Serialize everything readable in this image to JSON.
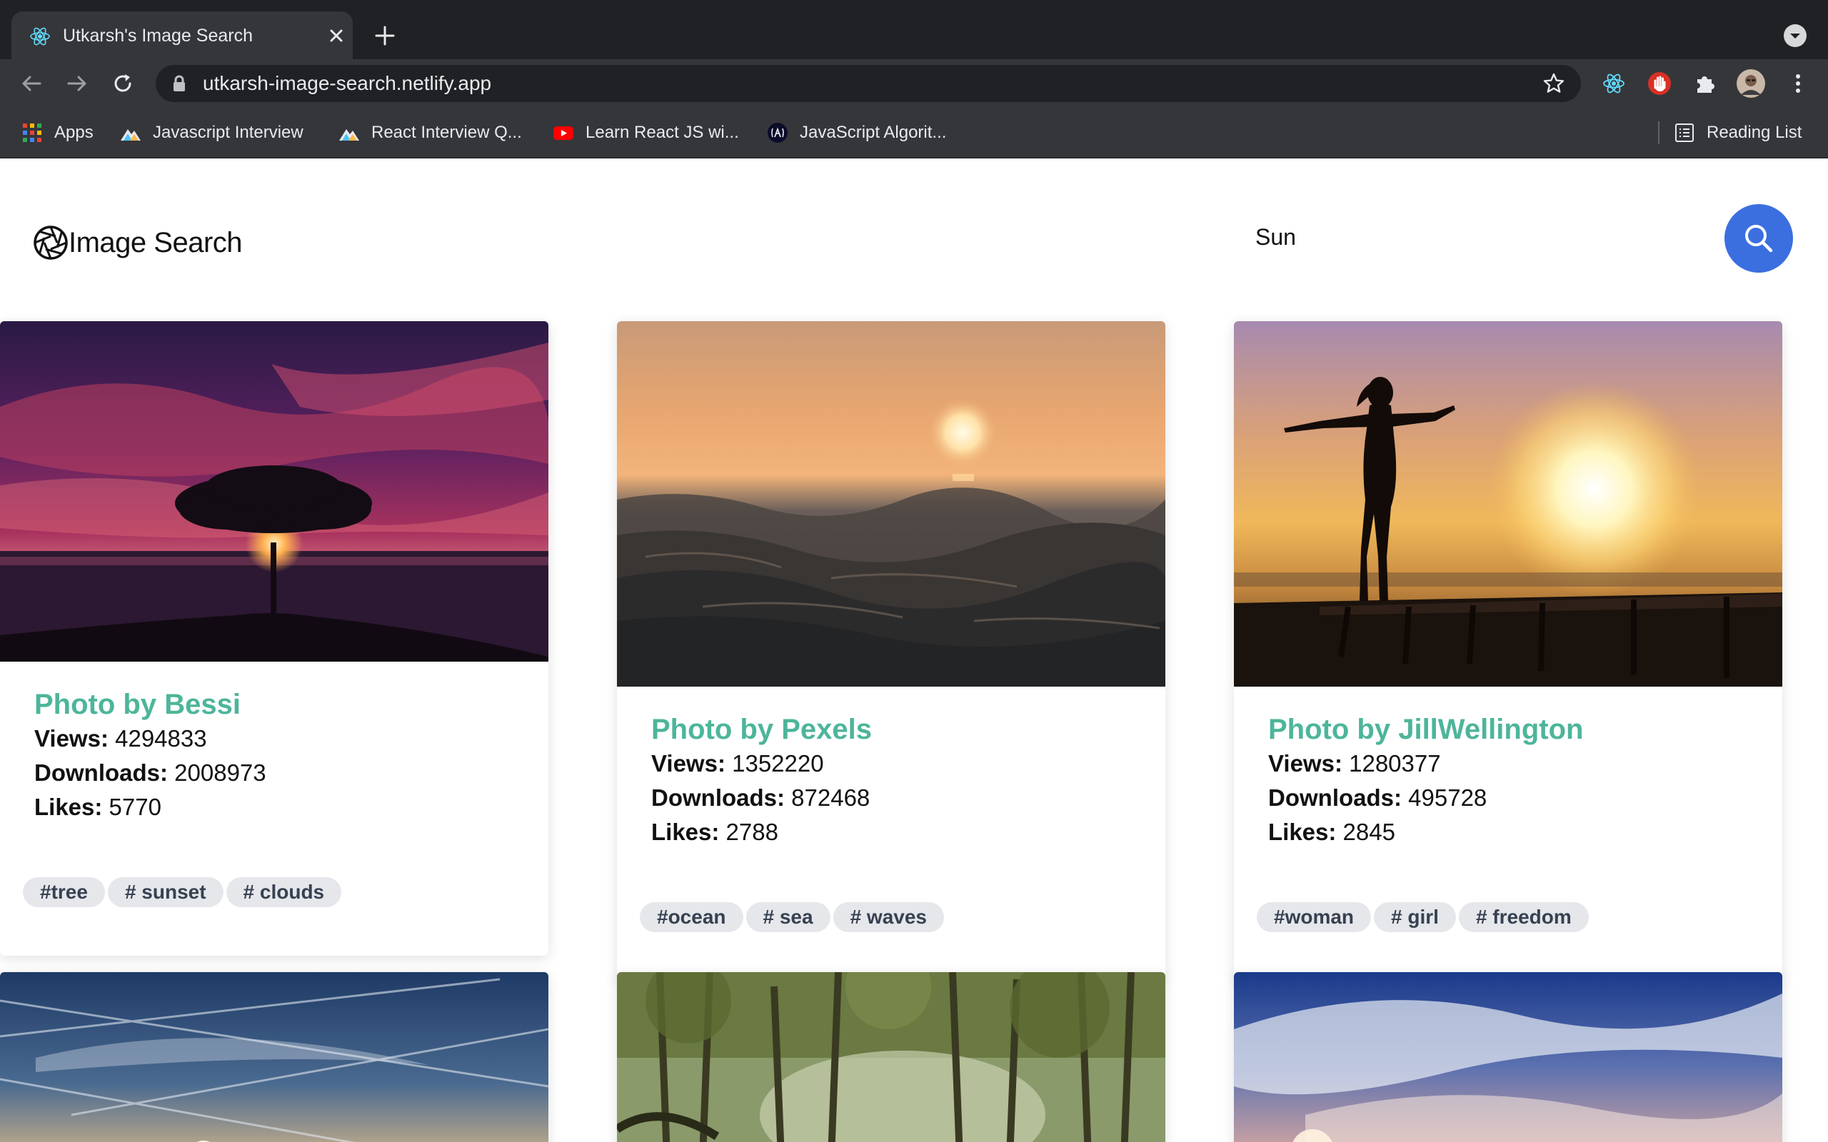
{
  "browser": {
    "tab_title": "Utkarsh's Image Search",
    "url": "utkarsh-image-search.netlify.app",
    "bookmarks": [
      {
        "label": "Apps",
        "icon": "apps-grid-icon"
      },
      {
        "label": "Javascript Interview",
        "icon": "mountain-icon"
      },
      {
        "label": "React Interview Q...",
        "icon": "mountain-icon"
      },
      {
        "label": "Learn React JS wi...",
        "icon": "youtube-icon"
      },
      {
        "label": "JavaScript Algorit...",
        "icon": "lambda-icon"
      }
    ],
    "reading_list": "Reading List",
    "accent": "#3b6fe0"
  },
  "header": {
    "brand": "Image Search",
    "search_value": "Sun"
  },
  "cards": [
    {
      "author": "Photo by Bessi",
      "views_label": "Views:",
      "views": "4294833",
      "downloads_label": "Downloads:",
      "downloads": "2008973",
      "likes_label": "Likes:",
      "likes": "5770",
      "tags": [
        "#tree",
        "# sunset",
        "# clouds"
      ]
    },
    {
      "author": "Photo by Pexels",
      "views_label": "Views:",
      "views": "1352220",
      "downloads_label": "Downloads:",
      "downloads": "872468",
      "likes_label": "Likes:",
      "likes": "2788",
      "tags": [
        "#ocean",
        "# sea",
        "# waves"
      ]
    },
    {
      "author": "Photo by JillWellington",
      "views_label": "Views:",
      "views": "1280377",
      "downloads_label": "Downloads:",
      "downloads": "495728",
      "likes_label": "Likes:",
      "likes": "2845",
      "tags": [
        "#woman",
        "# girl",
        "# freedom"
      ]
    }
  ]
}
